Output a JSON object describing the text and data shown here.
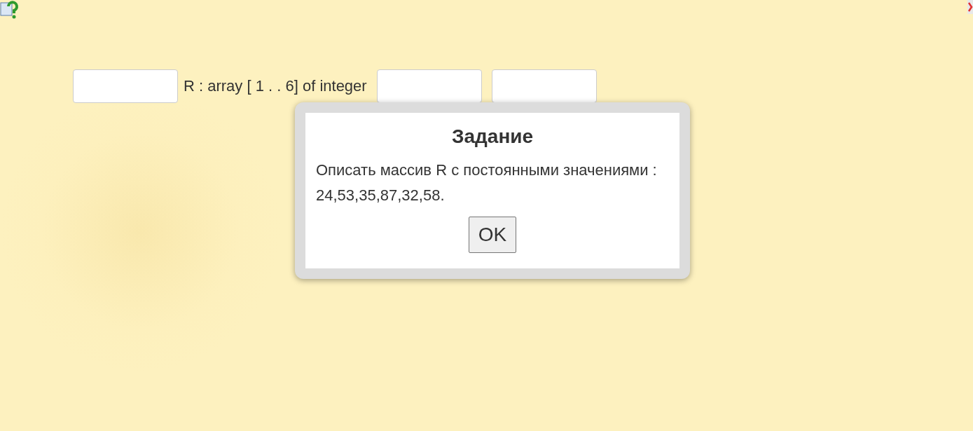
{
  "row": {
    "label": "R : array [ 1 . . 6] of integer"
  },
  "dialog": {
    "title": "Задание",
    "text": "Описать массив R с постоянными значениями : 24,53,35,87,32,58.",
    "button": "OK"
  }
}
